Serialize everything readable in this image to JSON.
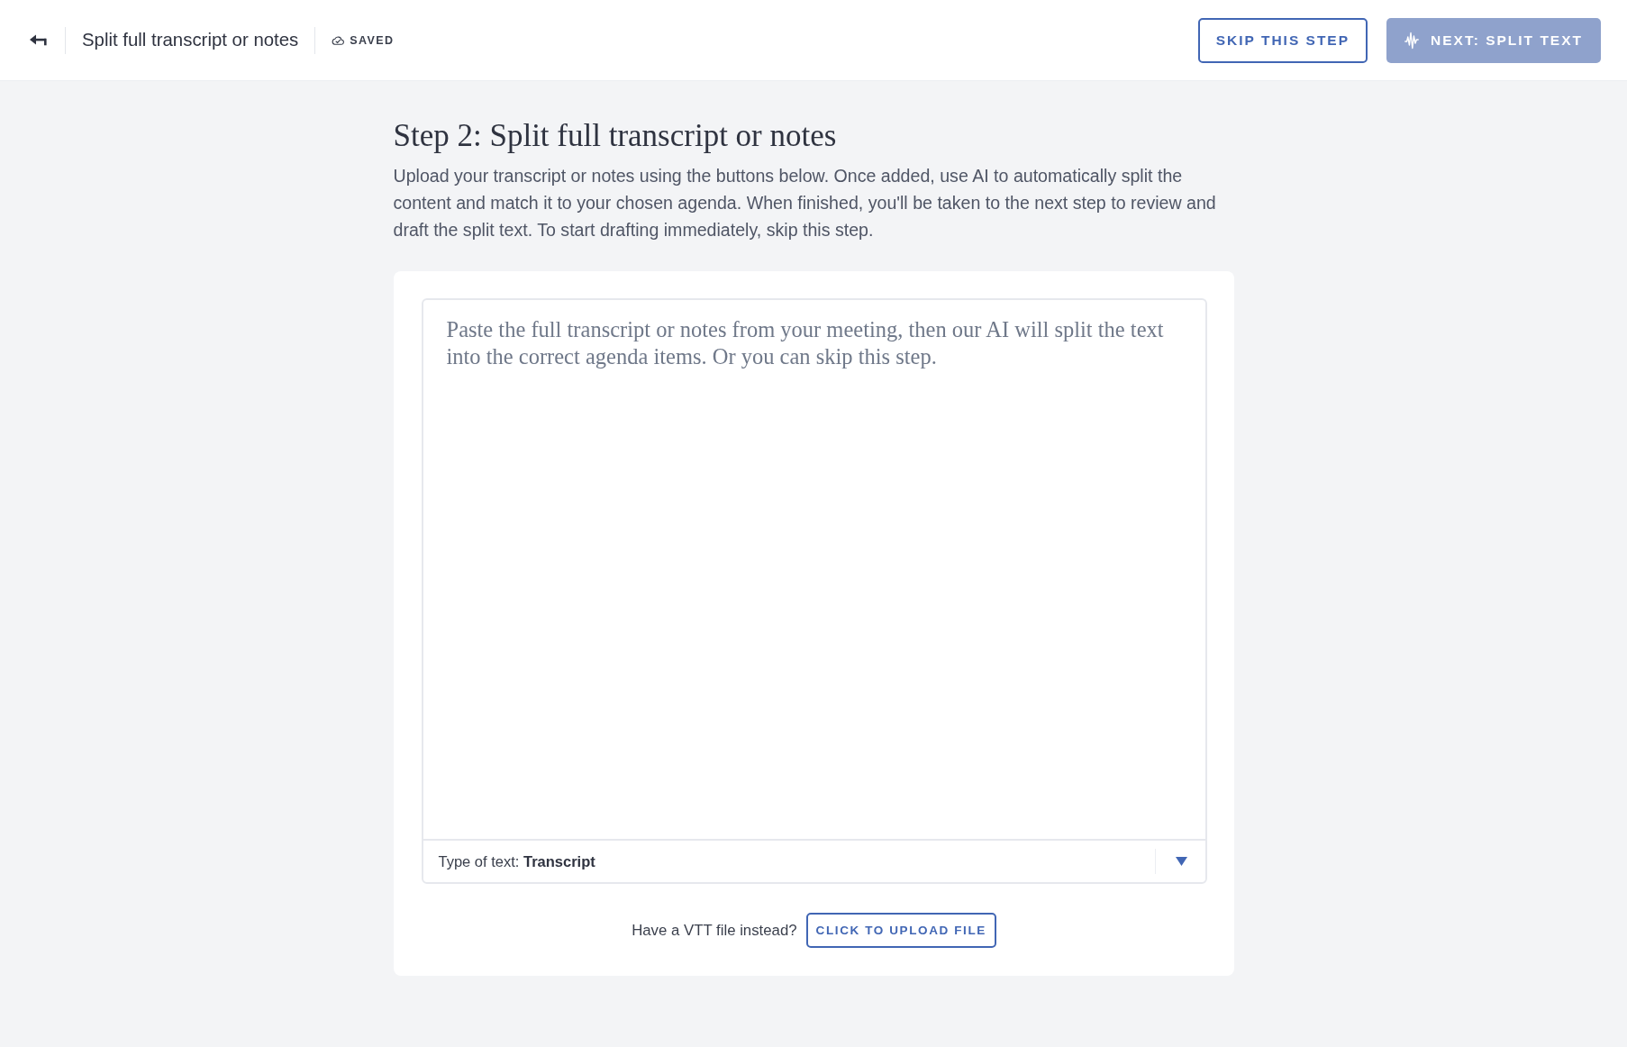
{
  "header": {
    "title": "Split full transcript or notes",
    "save_status": "SAVED",
    "buttons": [
      {
        "label": "SKIP THIS STEP",
        "kind": "outline",
        "disabled": false
      },
      {
        "label": "NEXT: SPLIT TEXT",
        "kind": "primary",
        "disabled": true
      }
    ]
  },
  "step": {
    "heading": "Step 2: Split full transcript or notes",
    "description": "Upload your transcript or notes using the buttons below. Once added, use AI to automatically split the content and match it to your chosen agenda. When finished, you'll be taken to the next step to review and draft the split text. To start drafting immediately, skip this step."
  },
  "editor": {
    "placeholder": "Paste the full transcript or notes from your meeting, then our AI will split the text into the correct agenda items. Or you can skip this step.",
    "text_type": {
      "label": "Type of text:",
      "value": "Transcript"
    }
  },
  "upload": {
    "prompt": "Have a VTT file instead?",
    "button": "CLICK TO UPLOAD FILE"
  }
}
